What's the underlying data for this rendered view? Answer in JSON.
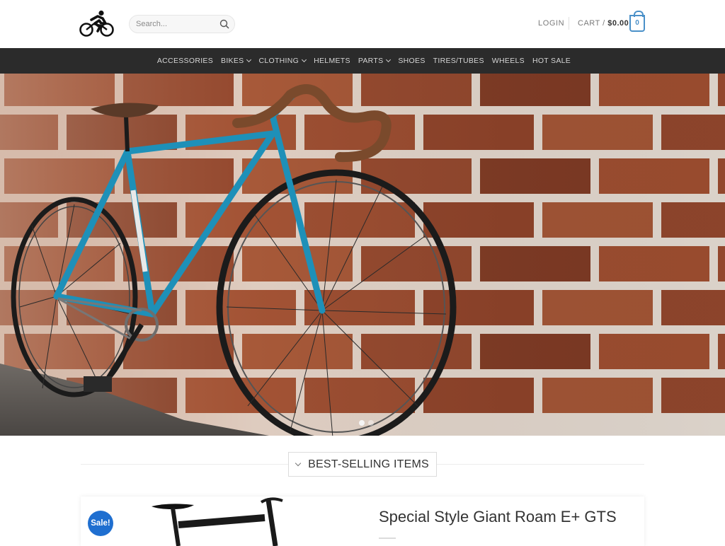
{
  "header": {
    "logo_icon": "cyclist-logo-icon",
    "search": {
      "placeholder": "Search...",
      "value": "",
      "icon": "search-icon"
    },
    "login_label": "LOGIN",
    "cart": {
      "label": "CART /",
      "amount": "$0.00",
      "count": "0",
      "icon": "cart-bag-icon"
    }
  },
  "nav": {
    "items": [
      {
        "label": "ACCESSORIES",
        "has_dropdown": false
      },
      {
        "label": "BIKES",
        "has_dropdown": true
      },
      {
        "label": "CLOTHING",
        "has_dropdown": true
      },
      {
        "label": "HELMETS",
        "has_dropdown": false
      },
      {
        "label": "PARTS",
        "has_dropdown": true
      },
      {
        "label": "SHOES",
        "has_dropdown": false
      },
      {
        "label": "TIRES/TUBES",
        "has_dropdown": false
      },
      {
        "label": "WHEELS",
        "has_dropdown": false
      },
      {
        "label": "HOT SALE",
        "has_dropdown": false
      }
    ]
  },
  "hero": {
    "image": "blue-road-bike-against-brick-wall",
    "slides": 2,
    "active_slide": 1
  },
  "section": {
    "title": "BEST-SELLING ITEMS"
  },
  "product": {
    "badge": "Sale!",
    "title": "Special Style Giant Roam E+ GTS",
    "image": "black-e-bike"
  },
  "colors": {
    "nav_bg": "#2b2b2b",
    "accent_blue": "#4a90c8",
    "sale_badge": "#1f6fd0",
    "brick": "#9a4b2f",
    "bike_frame": "#1e90b8"
  }
}
